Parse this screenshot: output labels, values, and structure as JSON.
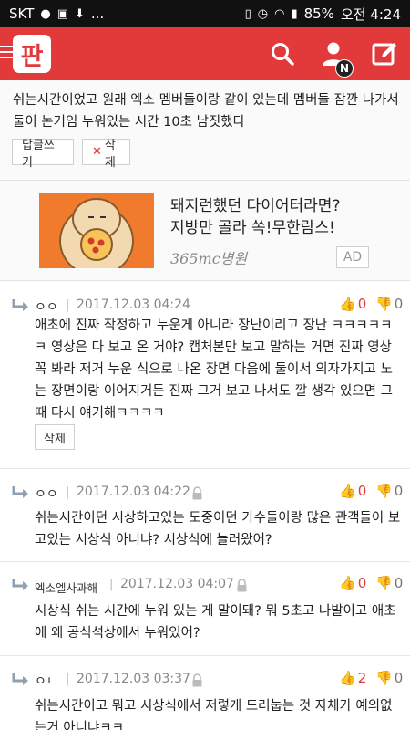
{
  "status_bar": {
    "carrier": "SKT",
    "ellipsis": "...",
    "battery": "85%",
    "time": "오전 4:24"
  },
  "header": {
    "logo_text": "판",
    "notification_badge": "N",
    "icons": [
      "menu-icon",
      "search-icon",
      "user-icon",
      "write-icon"
    ],
    "brand_color": "#e2393b"
  },
  "original_comment": {
    "text": "쉬는시간이었고 원래 엑소 멤버들이랑 같이 있는데 멤버들 잠깐 나가서 둘이 논거임 누워있는 시간 10초 남짓했다",
    "reply_button": "답글쓰기",
    "delete_button": "삭제"
  },
  "ad": {
    "title": "돼지런했던 다이어터라면?",
    "subtitle": "지방만 골라 쏙!무한람스!",
    "brand": "365mc병원",
    "tag": "AD"
  },
  "replies": [
    {
      "nickname": "ㅇㅇ",
      "date": "2017.12.03 04:24",
      "likes": "0",
      "dislikes": "0",
      "text": "애초에 진짜 작정하고 누운게 아니라 장난이리고 장난 ㅋㅋㅋㅋㅋㅋ 영상은 다 보고 온 거야? 캡처본만 보고 말하는 거면 진짜 영상 꼭 봐라 저거 누운 식으로 나온 장면 다음에 둘이서 의자가지고 노는 장면이랑 이어지거든 진짜 그거 보고 나서도 깔 생각 있으면 그때 다시 얘기해ㅋㅋㅋㅋ",
      "delete_button": "삭제"
    },
    {
      "nickname": "ㅇㅇ",
      "date": "2017.12.03 04:22",
      "likes": "0",
      "dislikes": "0",
      "text": "쉬는시간이던 시상하고있는 도중이던 가수들이랑 많은 관객들이 보고있는 시상식 아니냐? 시상식에 놀러왔어?"
    },
    {
      "nickname": "엑소엘사과해",
      "date": "2017.12.03 04:07",
      "likes": "0",
      "dislikes": "0",
      "text": "시상식 쉬는 시간에 누워 있는 게 말이돼? 뭐 5초고 나발이고 애초에 왜 공식석상에서 누워있어?"
    },
    {
      "nickname": "ㅇㄴ",
      "date": "2017.12.03 03:37",
      "likes": "2",
      "dislikes": "0",
      "text": "쉬는시간이고 뭐고 시상식에서 저렇게 드러눕는 것 자체가 예의없는거 아니냐ㅋㅋ"
    }
  ]
}
